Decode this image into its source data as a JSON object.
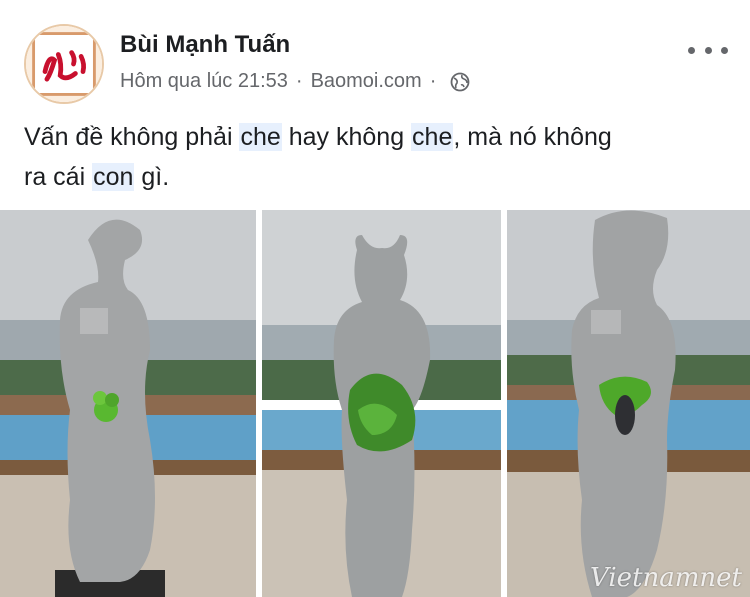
{
  "post": {
    "author": "Bùi Mạnh Tuấn",
    "time": "Hôm qua lúc 21:53",
    "separator": "·",
    "source": "Baomoi.com",
    "separator2": "·",
    "privacy_icon": "globe-icon",
    "more_icon": "more-options-icon"
  },
  "text": {
    "line1_a": "Vấn đề không phải ",
    "line1_hl1": "che",
    "line1_b": " hay không ",
    "line1_hl2": "che",
    "line1_c": ", mà nó không",
    "line2_a": "ra cái ",
    "line2_hl": "con",
    "line2_b": " gì."
  },
  "photos": {
    "watermark": "Vietnamnet"
  },
  "colors": {
    "name": "#1c1e21",
    "meta": "#65676b",
    "highlight": "#e7f0fd"
  }
}
